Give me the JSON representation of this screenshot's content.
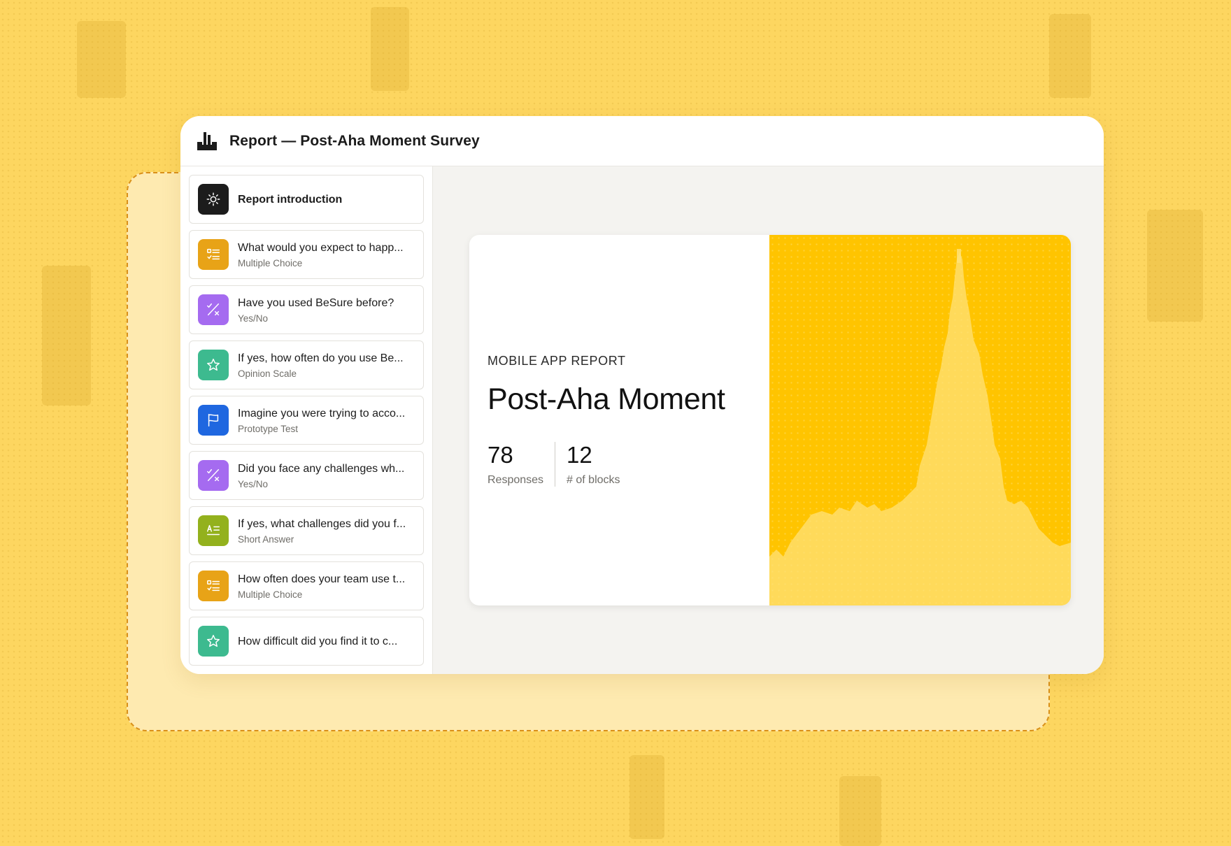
{
  "window": {
    "title": "Report — Post-Aha Moment Survey"
  },
  "sidebar": {
    "items": [
      {
        "title": "Report introduction",
        "type": "",
        "icon": "sun-icon",
        "color": "#1c1c1c"
      },
      {
        "title": "What would you expect to happ...",
        "type": "Multiple Choice",
        "icon": "checklist-icon",
        "color": "#e8a317"
      },
      {
        "title": "Have you used BeSure before?",
        "type": "Yes/No",
        "icon": "yes-no-icon",
        "color": "#a56bf0"
      },
      {
        "title": "If yes, how often do you use Be...",
        "type": "Opinion Scale",
        "icon": "star-icon",
        "color": "#3dba8f"
      },
      {
        "title": "Imagine you were trying to acco...",
        "type": "Prototype Test",
        "icon": "flag-icon",
        "color": "#1f67e0"
      },
      {
        "title": "Did you face any challenges wh...",
        "type": "Yes/No",
        "icon": "yes-no-icon",
        "color": "#a56bf0"
      },
      {
        "title": "If yes, what challenges did you f...",
        "type": "Short Answer",
        "icon": "short-answer-icon",
        "color": "#93b11d"
      },
      {
        "title": "How often does your team use t...",
        "type": "Multiple Choice",
        "icon": "checklist-icon",
        "color": "#e8a317"
      },
      {
        "title": "How difficult did you find it to c...",
        "type": "",
        "icon": "star-icon",
        "color": "#3dba8f"
      }
    ]
  },
  "report": {
    "eyebrow": "MOBILE APP REPORT",
    "title": "Post-Aha Moment",
    "stats": [
      {
        "value": "78",
        "label": "Responses"
      },
      {
        "value": "12",
        "label": "# of blocks"
      }
    ]
  },
  "colors": {
    "background": "#fdd660",
    "accent": "#ffc400"
  }
}
